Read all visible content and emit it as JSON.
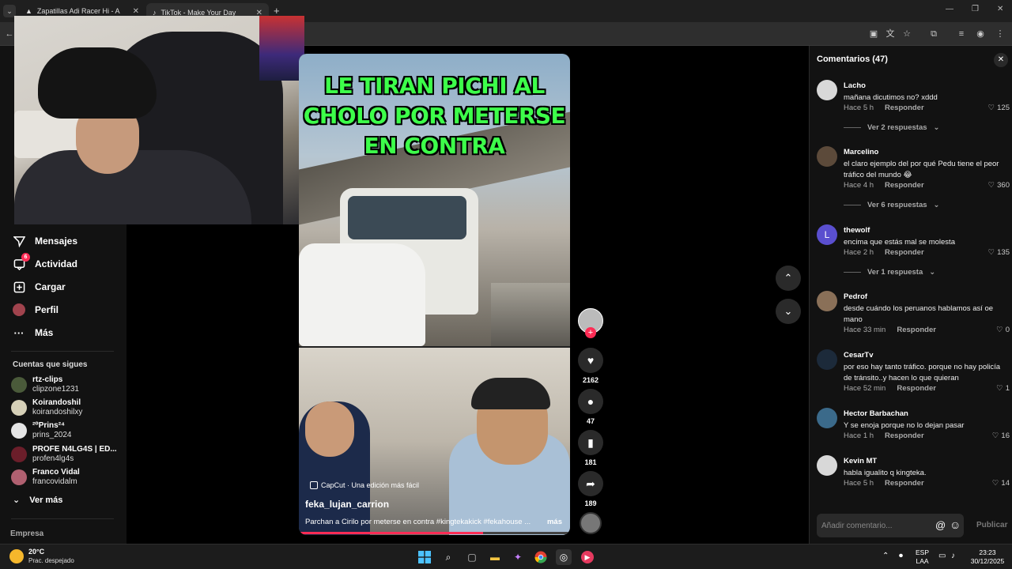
{
  "browser": {
    "tabs": [
      {
        "title": "Zapatillas Adi Racer Hi - Azul a"
      },
      {
        "title": "TikTok - Make Your Day"
      }
    ]
  },
  "sidebar": {
    "nav": [
      {
        "label": "Mensajes",
        "icon": "send-icon"
      },
      {
        "label": "Actividad",
        "icon": "activity-icon",
        "badge": "6"
      },
      {
        "label": "Cargar",
        "icon": "upload-icon"
      },
      {
        "label": "Perfil",
        "icon": "profile-avatar-icon"
      },
      {
        "label": "Más",
        "icon": "more-dots-icon"
      }
    ],
    "following_title": "Cuentas que sigues",
    "following": [
      {
        "name": "rtz-clips",
        "handle": "clipzone1231"
      },
      {
        "name": "Koirandoshil",
        "handle": "koirandoshilxy"
      },
      {
        "name": "²⁰Prins²⁴",
        "handle": "prins_2024"
      },
      {
        "name": "PROFE N4LG4S | ED...",
        "handle": "profen4lg4s"
      },
      {
        "name": "Franco Vidal",
        "handle": "francovidalm"
      }
    ],
    "see_more": "Ver más",
    "company": "Empresa"
  },
  "video": {
    "overlay_title": "LE TIRAN PICHI AL CHOLO POR METERSE EN CONTRA",
    "capcut": "CapCut · Una edición más fácil",
    "author": "feka_lujan_carrion",
    "description": "Parchan a Cirilo por meterse en contra #kingtekakick #fekahouse ...",
    "more": "más",
    "progress": 0.68
  },
  "actions": {
    "likes": "2162",
    "comments": "47",
    "saves": "181",
    "shares": "189"
  },
  "comments_panel": {
    "title": "Comentarios (47)",
    "reply_label": "Responder",
    "items": [
      {
        "user": "Lacho",
        "text": "mañana dicutimos no? xddd",
        "time": "Hace 5 h",
        "likes": "125",
        "replies": "Ver 2 respuestas"
      },
      {
        "user": "Marcelino",
        "text": "el claro ejemplo del por qué Pedu tiene el peor tráfico del mundo 😂",
        "time": "Hace 4 h",
        "likes": "360",
        "replies": "Ver 6 respuestas"
      },
      {
        "user": "thewolf",
        "text": "encima que estás mal se molesta",
        "time": "Hace 2 h",
        "likes": "135",
        "replies": "Ver 1 respuesta",
        "avatar_letter": "L"
      },
      {
        "user": "Pedrof",
        "text": "desde cuándo los peruanos hablamos así oe mano",
        "time": "Hace 33 min",
        "likes": "0"
      },
      {
        "user": "CesarTv",
        "text": "por eso hay tanto tráfico. porque no hay policía de tránsito..y hacen lo que quieran",
        "time": "Hace 52 min",
        "likes": "1"
      },
      {
        "user": "Hector Barbachan",
        "text": "Y se enoja porque no lo dejan pasar",
        "time": "Hace 1 h",
        "likes": "16"
      },
      {
        "user": "Kevin MT",
        "text": "habla igualito q kingteka.",
        "time": "Hace 5 h",
        "likes": "14"
      }
    ],
    "input_placeholder": "Añadir comentario...",
    "publish": "Publicar"
  },
  "taskbar": {
    "temp": "20°C",
    "weather": "Prac. despejado",
    "lang1": "ESP",
    "lang2": "LAA",
    "time": "23:23",
    "date": "30/12/2025"
  },
  "colors": {
    "accent": "#fe2c55",
    "title_green": "#3dff4a"
  }
}
